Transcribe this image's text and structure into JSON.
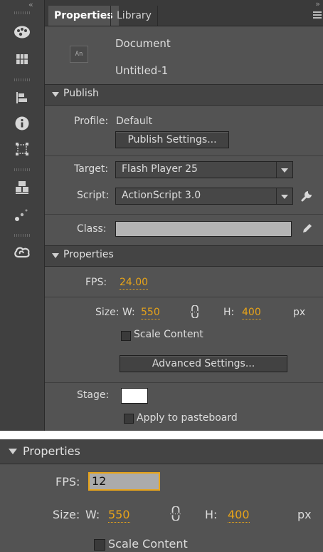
{
  "tabs": [
    {
      "label": "Properties"
    },
    {
      "label": "Library"
    }
  ],
  "tools": [
    {
      "icon": "palette-icon"
    },
    {
      "icon": "swatches-grid-icon"
    },
    {
      "icon": "align-icon"
    },
    {
      "icon": "info-icon"
    },
    {
      "icon": "transform-icon"
    },
    {
      "icon": "components-icon"
    },
    {
      "icon": "motion-presets-icon"
    },
    {
      "icon": "creative-cloud-icon"
    }
  ],
  "document": {
    "type_label": "Document",
    "icon_text": "An",
    "name": "Untitled-1"
  },
  "publish": {
    "header": "Publish",
    "profile_label": "Profile:",
    "profile_value": "Default",
    "publish_settings_button": "Publish Settings...",
    "target_label": "Target:",
    "target_value": "Flash Player 25",
    "script_label": "Script:",
    "script_value": "ActionScript 3.0",
    "class_label": "Class:",
    "class_value": ""
  },
  "properties": {
    "header": "Properties",
    "fps_label": "FPS:",
    "fps_value": "24.00",
    "size_label": "Size:",
    "w_label": "W:",
    "w_value": "550",
    "h_label": "H:",
    "h_value": "400",
    "unit": "px",
    "scale_content_label": "Scale Content",
    "advanced_settings_button": "Advanced Settings...",
    "stage_label": "Stage:",
    "stage_color": "#ffffff",
    "apply_to_pasteboard_label": "Apply to pasteboard"
  },
  "properties_edit": {
    "header": "Properties",
    "fps_label": "FPS:",
    "fps_value": "12",
    "size_label": "Size:",
    "w_label": "W:",
    "w_value": "550",
    "h_label": "H:",
    "h_value": "400",
    "unit": "px",
    "scale_content_label": "Scale Content"
  },
  "colors": {
    "panel": "#535353",
    "accent": "#e8a419",
    "toolbar": "#404040"
  }
}
